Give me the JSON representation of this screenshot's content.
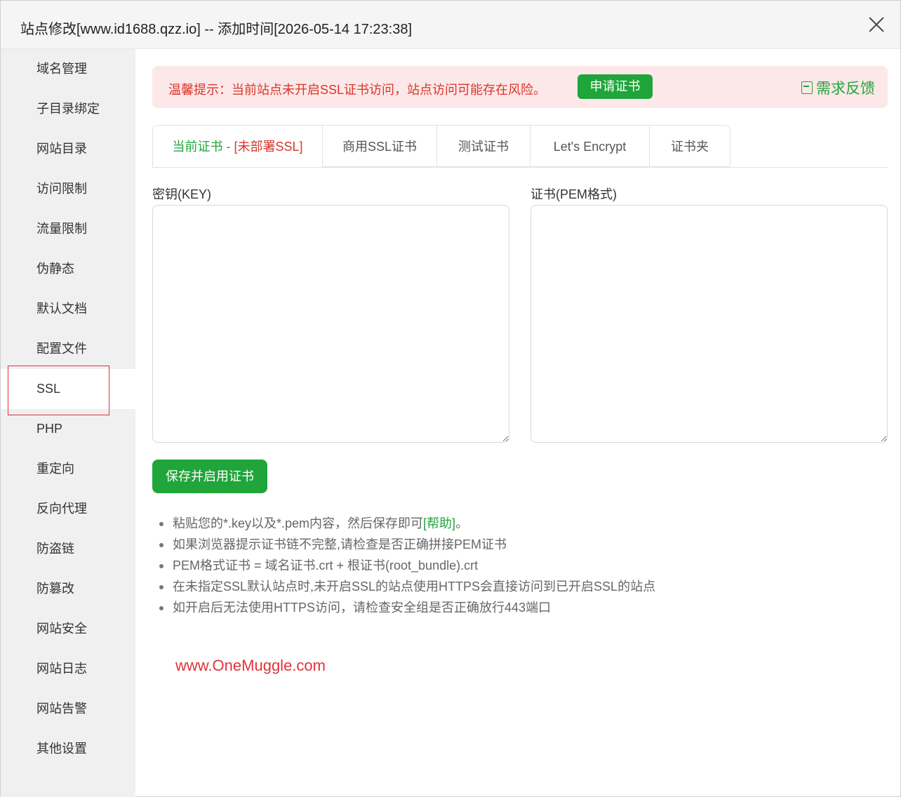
{
  "window": {
    "title": "站点修改[www.id1688.qzz.io] -- 添加时间[2026-05-14 17:23:38]"
  },
  "sidebar": {
    "items": [
      {
        "label": "域名管理"
      },
      {
        "label": "子目录绑定"
      },
      {
        "label": "网站目录"
      },
      {
        "label": "访问限制"
      },
      {
        "label": "流量限制"
      },
      {
        "label": "伪静态"
      },
      {
        "label": "默认文档"
      },
      {
        "label": "配置文件"
      },
      {
        "label": "SSL",
        "active": true
      },
      {
        "label": "PHP"
      },
      {
        "label": "重定向"
      },
      {
        "label": "反向代理"
      },
      {
        "label": "防盗链"
      },
      {
        "label": "防篡改"
      },
      {
        "label": "网站安全"
      },
      {
        "label": "网站日志"
      },
      {
        "label": "网站告警"
      },
      {
        "label": "其他设置"
      }
    ]
  },
  "alert": {
    "text": "温馨提示：当前站点未开启SSL证书访问，站点访问可能存在风险。",
    "apply_label": "申请证书",
    "feedback_label": "需求反馈"
  },
  "tabs": {
    "current_prefix": "当前证书 - ",
    "current_status": "[未部署SSL]",
    "commercial": "商用SSL证书",
    "test": "测试证书",
    "letsencrypt": "Let's Encrypt",
    "folder": "证书夹"
  },
  "form": {
    "key_label": "密钥(KEY)",
    "key_value": "",
    "cert_label": "证书(PEM格式)",
    "cert_value": "",
    "save_label": "保存并启用证书"
  },
  "tips": {
    "tip1_text": "粘贴您的*.key以及*.pem内容，然后保存即可",
    "tip1_help": "[帮助]",
    "tip1_end": "。",
    "tip2": "如果浏览器提示证书链不完整,请检查是否正确拼接PEM证书",
    "tip3": "PEM格式证书 = 域名证书.crt + 根证书(root_bundle).crt",
    "tip4": "在未指定SSL默认站点时,未开启SSL的站点使用HTTPS会直接访问到已开启SSL的站点",
    "tip5": "如开启后无法使用HTTPS访问，请检查安全组是否正确放行443端口"
  },
  "watermark": "www.OneMuggle.com",
  "colors": {
    "accent_green": "#20a53a",
    "warning_red": "#d9352b",
    "alert_bg": "#fce8e8",
    "sidebar_bg": "#f0f0f0"
  }
}
